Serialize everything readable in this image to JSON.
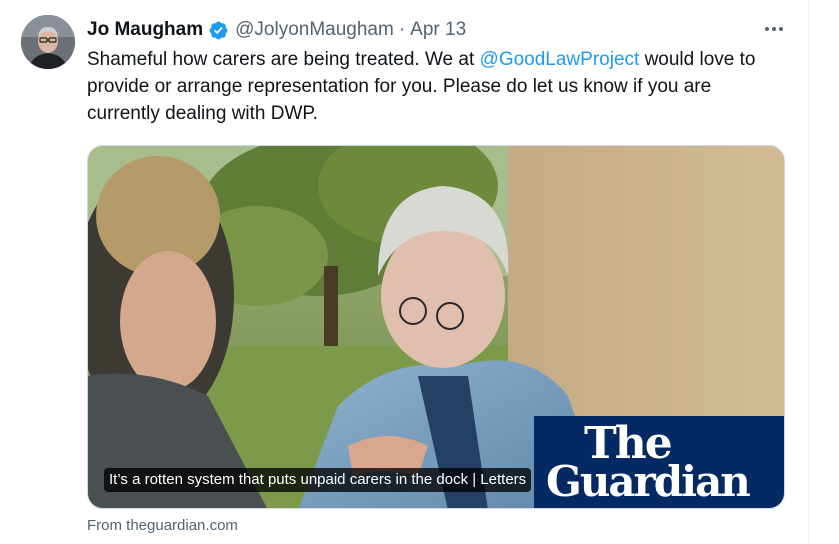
{
  "tweet": {
    "author_name": "Jo Maugham",
    "verified_icon": "verified-badge-icon",
    "handle": "@JolyonMaugham",
    "separator": "·",
    "date": "Apr 13",
    "more_icon": "more-options-icon",
    "text_before": "Shameful how carers are being treated. We at ",
    "mention": "@GoodLawProject",
    "text_after": " would love to provide or arrange representation for you. Please do let us know if you are currently dealing with DWP."
  },
  "card": {
    "caption": "It’s a rotten system that puts unpaid carers in the dock | Letters",
    "brand_line1": "The",
    "brand_line2": "Guardian",
    "source": "From theguardian.com"
  },
  "colors": {
    "accent": "#1d9bf0",
    "text": "#0f1419",
    "secondary": "#536471",
    "guardian_blue": "#052962"
  }
}
